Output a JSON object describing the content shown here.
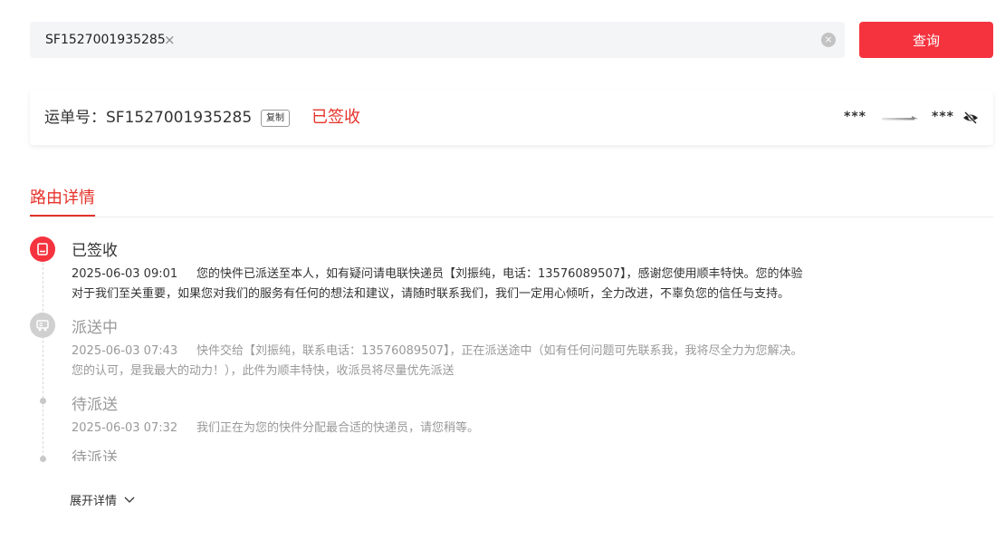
{
  "search": {
    "chip_text": "SF1527001935285",
    "chip_remove": "×",
    "clear": "×",
    "query_label": "查询"
  },
  "waybill": {
    "label": "运单号：SF1527001935285",
    "copy_label": "复制",
    "status": "已签收",
    "from": "***",
    "to": "***"
  },
  "tab": {
    "label": "路由详情"
  },
  "timeline": [
    {
      "title": "已签收",
      "time": "2025-06-03 09:01",
      "desc_line1": "您的快件已派送至本人，如有疑问请电联快递员【刘振纯，电话：13576089507】，感谢您使用顺丰特快。您的体验",
      "desc_line2": "对于我们至关重要，如果您对我们的服务有任何的想法和建议，请随时联系我们，我们一定用心倾听，全力改进，不辜负您的信任与支持。"
    },
    {
      "title": "派送中",
      "time": "2025-06-03 07:43",
      "desc_line1": "快件交给【刘振纯，联系电话：13576089507】，正在派送途中（如有任何问题可先联系我，我将尽全力为您解决。",
      "desc_line2": "您的认可，是我最大的动力！），此件为顺丰特快，收派员将尽量优先派送"
    },
    {
      "title": "待派送",
      "time": "2025-06-03 07:32",
      "desc_line1": "我们正在为您的快件分配最合适的快递员，请您稍等。"
    },
    {
      "title": "待派送"
    }
  ],
  "expand_label": "展开详情",
  "colors": {
    "accent": "#e5332a",
    "button": "#f5333f",
    "muted": "#999999"
  }
}
